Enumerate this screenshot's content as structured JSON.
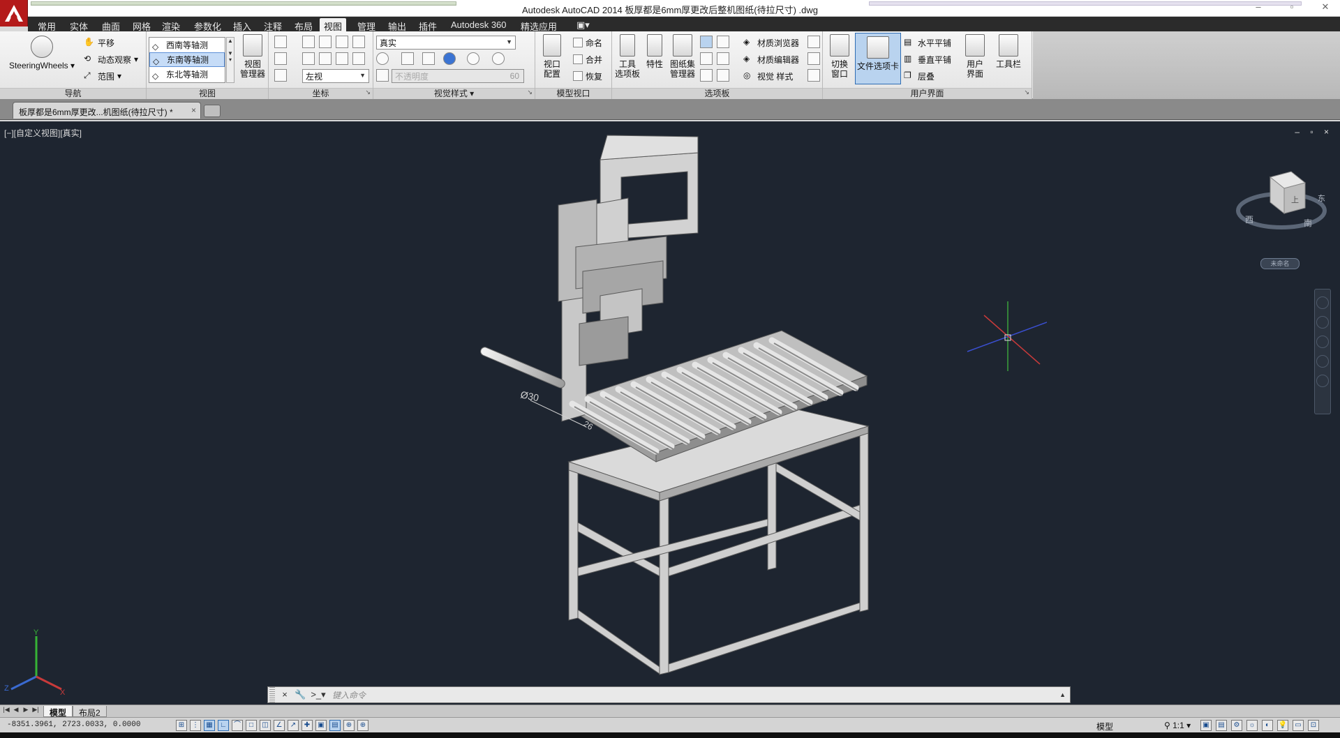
{
  "title": "Autodesk AutoCAD 2014    板厚都是6mm厚更改后整机图纸(待拉尺寸) .dwg",
  "ribbon_tabs": [
    "常用",
    "实体",
    "曲面",
    "网格",
    "渲染",
    "参数化",
    "插入",
    "注释",
    "布局",
    "视图",
    "管理",
    "输出",
    "插件",
    "Autodesk 360",
    "精选应用"
  ],
  "ribbon_tab_extra": "▣▾",
  "active_tab": "视图",
  "navigate": {
    "steering": "SteeringWheels",
    "pan": "平移",
    "orbit": "动态观察",
    "extents": "范围",
    "title": "导航"
  },
  "views": {
    "items": [
      "西南等轴测",
      "东南等轴测",
      "东北等轴测"
    ],
    "selected": "东南等轴测",
    "manager": "视图\n管理器",
    "title": "视图"
  },
  "coordinates": {
    "view_value": "左视",
    "title": "坐标"
  },
  "visual_styles": {
    "current": "真实",
    "opacity_placeholder": "不透明度",
    "opacity_value": "60",
    "title": "视觉样式"
  },
  "model_viewports": {
    "config": "视口\n配置",
    "named": "命名",
    "join": "合并",
    "restore": "恢复",
    "title": "模型视口"
  },
  "palettes": {
    "tool_palette": "工具\n选项板",
    "properties": "特性",
    "sheetset": "图纸集\n管理器",
    "materials_browser": "材质浏览器",
    "materials_editor": "材质编辑器",
    "visual_styles": "视觉 样式",
    "title": "选项板"
  },
  "user_interface": {
    "switch_window": "切换\n窗口",
    "file_tabs": "文件选项卡",
    "tile_h": "水平平铺",
    "tile_v": "垂直平铺",
    "cascade": "层叠",
    "user_interface": "用户\n界面",
    "toolbars": "工具栏",
    "title": "用户界面"
  },
  "file_tab": {
    "name": "板厚都是6mm厚更改...机图纸(待拉尺寸)",
    "modified_mark": "*",
    "close": "×"
  },
  "viewport": {
    "label": "[−][自定义视图][真实]",
    "controls": "– ▫ ×",
    "viewcube_unnamed": "未命名",
    "dimension_text": "Ø30",
    "dimension_text_2": "26",
    "viewcube_labels": [
      "西",
      "南",
      "东",
      "上"
    ]
  },
  "command_line": {
    "placeholder": "键入命令",
    "close": "×",
    "settings": "🔧",
    "prompt": ">_▾",
    "expand": "▲"
  },
  "layout_tabs": [
    "模型",
    "布局2"
  ],
  "active_layout": "模型",
  "status": {
    "coords": "-8351.3961,  2723.0033, 0.0000",
    "model": "模型",
    "scale": "1:1"
  },
  "colors": {
    "viewport_bg": "#1e2530",
    "ribbon_tabs_bg": "#2b2b2b",
    "app_red": "#b41a1a",
    "model_fill": "#cfcfcf"
  },
  "icons": [
    "app-logo-icon",
    "pan-icon",
    "orbit-icon",
    "extents-icon",
    "viewcube-icon",
    "ucs-icon",
    "crosshair-icon"
  ]
}
